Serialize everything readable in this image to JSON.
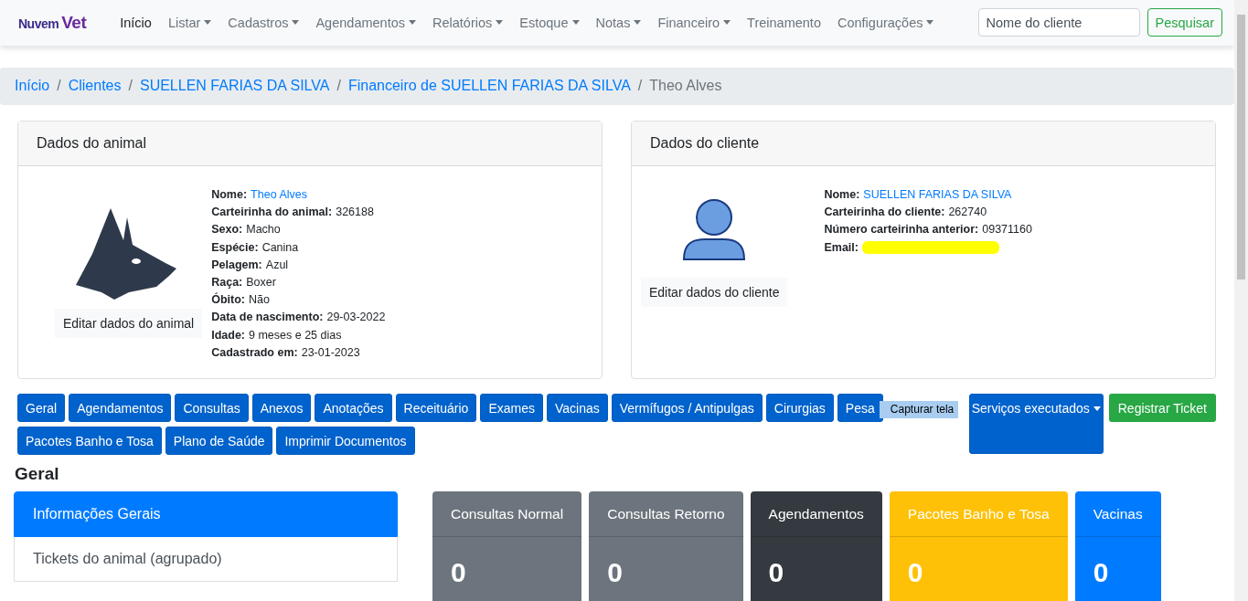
{
  "navbar": {
    "brand": {
      "part1": "Nuvem",
      "part2": "Vet"
    },
    "items": [
      {
        "label": "Início",
        "selected": true,
        "dropdown": false
      },
      {
        "label": "Listar",
        "selected": false,
        "dropdown": true
      },
      {
        "label": "Cadastros",
        "selected": false,
        "dropdown": true
      },
      {
        "label": "Agendamentos",
        "selected": false,
        "dropdown": true
      },
      {
        "label": "Relatórios",
        "selected": false,
        "dropdown": true
      },
      {
        "label": "Estoque",
        "selected": false,
        "dropdown": true
      },
      {
        "label": "Notas",
        "selected": false,
        "dropdown": true
      },
      {
        "label": "Financeiro",
        "selected": false,
        "dropdown": true
      },
      {
        "label": "Treinamento",
        "selected": false,
        "dropdown": false
      },
      {
        "label": "Configurações",
        "selected": false,
        "dropdown": true
      }
    ],
    "search": {
      "placeholder": "Nome do cliente",
      "button": "Pesquisar"
    }
  },
  "breadcrumb": [
    {
      "label": "Início",
      "kind": "link"
    },
    {
      "separator": "/",
      "label": "Clientes",
      "kind": "link"
    },
    {
      "separator": "/",
      "label": "SUELLEN FARIAS DA SILVA",
      "kind": "link"
    },
    {
      "separator": "/",
      "label": "Financeiro de SUELLEN FARIAS DA SILVA",
      "kind": "link"
    },
    {
      "separator": "/",
      "label": "Theo Alves",
      "kind": "current"
    }
  ],
  "animal_card": {
    "title": "Dados do animal",
    "edit_button": "Editar dados do animal",
    "fields": [
      {
        "label": "Nome:",
        "value": "Theo Alves",
        "kind": "link"
      },
      {
        "label": "Carteirinha do animal:",
        "value": "326188",
        "kind": "text"
      },
      {
        "label": "Sexo:",
        "value": "Macho",
        "kind": "text"
      },
      {
        "label": "Espécie:",
        "value": "Canina",
        "kind": "text"
      },
      {
        "label": "Pelagem:",
        "value": "Azul",
        "kind": "text"
      },
      {
        "label": "Raça:",
        "value": "Boxer",
        "kind": "text"
      },
      {
        "label": "Óbito:",
        "value": "Não",
        "kind": "text"
      },
      {
        "label": "Data de nascimento:",
        "value": "29-03-2022",
        "kind": "text"
      },
      {
        "label": "Idade:",
        "value": "9 meses e 25 dias",
        "kind": "text"
      },
      {
        "label": "Cadastrado em:",
        "value": "23-01-2023",
        "kind": "text"
      }
    ]
  },
  "client_card": {
    "title": "Dados do cliente",
    "edit_button": "Editar dados do cliente",
    "fields": [
      {
        "label": "Nome:",
        "value": "SUELLEN FARIAS DA SILVA",
        "kind": "link"
      },
      {
        "label": "Carteirinha do cliente:",
        "value": "262740",
        "kind": "text"
      },
      {
        "label": "Número carteirinha anterior:",
        "value": "09371160",
        "kind": "text"
      },
      {
        "label": "Email:",
        "kind": "redacted"
      }
    ]
  },
  "tabs": [
    {
      "label": "Geral"
    },
    {
      "label": "Agendamentos"
    },
    {
      "label": "Consultas"
    },
    {
      "label": "Anexos"
    },
    {
      "label": "Anotações"
    },
    {
      "label": "Receituário"
    },
    {
      "label": "Exames"
    },
    {
      "label": "Vacinas"
    },
    {
      "label": "Vermífugos / Antipulgas"
    },
    {
      "label": "Cirurgias"
    },
    {
      "label": "Pesa",
      "tooltip": "Capturar tela"
    },
    {
      "label": "Pacotes Banho e Tosa"
    },
    {
      "label": "Plano de Saúde"
    },
    {
      "label": "Imprimir Documentos"
    }
  ],
  "services_button": "Serviços executados",
  "ticket_button": "Registrar Ticket",
  "section_title": "Geral",
  "list_group": [
    {
      "label": "Informações Gerais",
      "selected": true
    },
    {
      "label": "Tickets do animal (agrupado)",
      "selected": false
    }
  ],
  "stats": [
    {
      "title": "Consultas Normal",
      "value": "0",
      "color": "#6c757d"
    },
    {
      "title": "Consultas Retorno",
      "value": "0",
      "color": "#6c757d"
    },
    {
      "title": "Agendamentos",
      "value": "0",
      "color": "#343a40"
    },
    {
      "title": "Pacotes Banho e Tosa",
      "value": "0",
      "color": "#ffc107"
    },
    {
      "title": "Vacinas",
      "value": "0",
      "color": "#007bff"
    }
  ]
}
